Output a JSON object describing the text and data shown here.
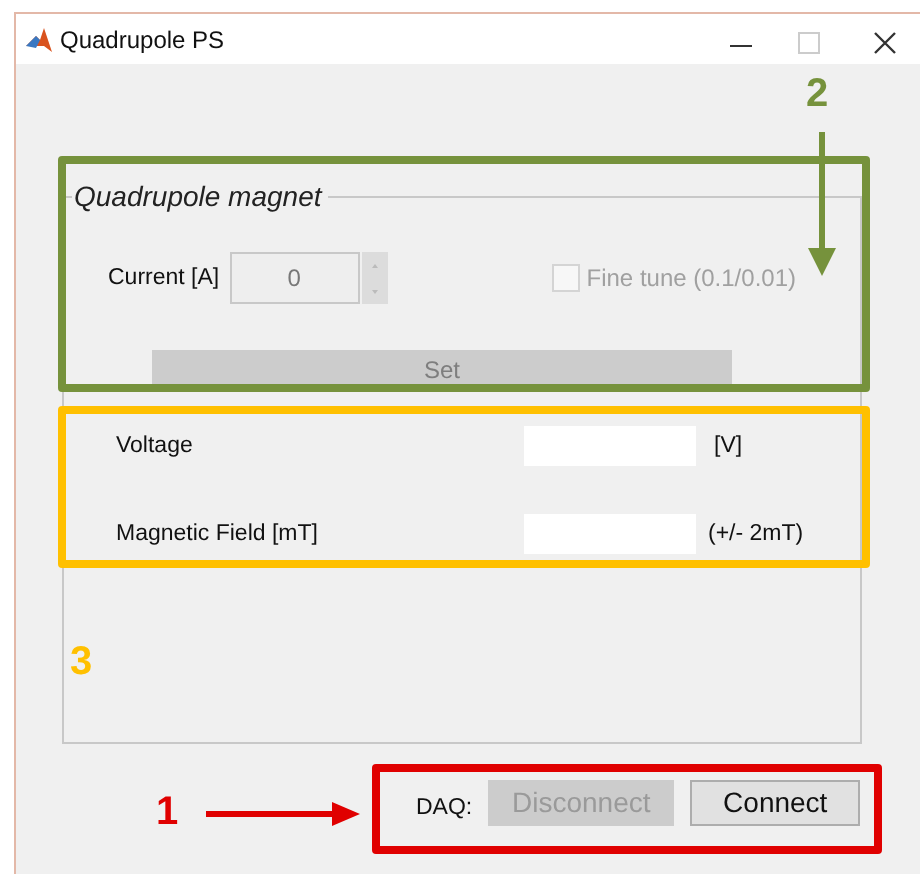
{
  "window": {
    "title": "Quadrupole PS"
  },
  "panel": {
    "title": "Quadrupole magnet",
    "current": {
      "label": "Current [A]",
      "value": "0",
      "disabled": true
    },
    "fine_tune": {
      "label": "Fine tune (0.1/0.01)",
      "checked": false,
      "disabled": true
    },
    "set_button": {
      "label": "Set",
      "disabled": true
    },
    "readings": [
      {
        "label": "Voltage",
        "unit": "[V]"
      },
      {
        "label": "Magnetic Field [mT]",
        "unit": "(+/-  2mT)"
      }
    ]
  },
  "daq": {
    "label": "DAQ:",
    "buttons": [
      {
        "label": "Disconnect",
        "disabled": true
      },
      {
        "label": "Connect",
        "disabled": false
      }
    ]
  },
  "annotations": [
    {
      "number": "2",
      "color": "#76923c",
      "kind": "arrow-down"
    },
    {
      "number": "3",
      "color": "#ffc000",
      "kind": "plain"
    },
    {
      "number": "1",
      "color": "#e00000",
      "kind": "arrow-right"
    }
  ]
}
